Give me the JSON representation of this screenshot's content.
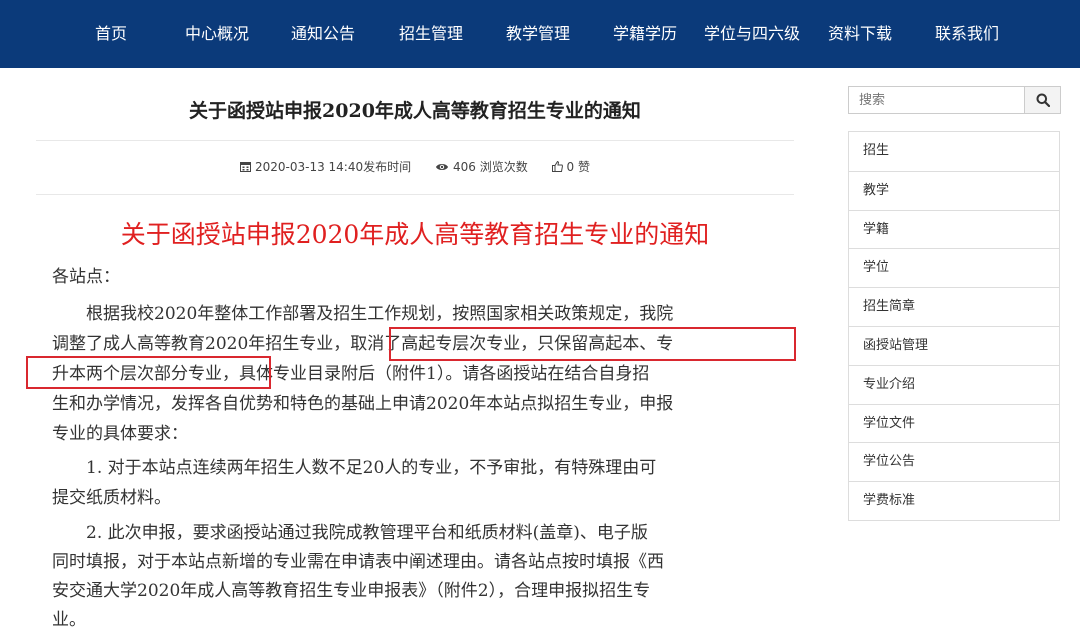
{
  "nav": {
    "items": [
      "首页",
      "中心概况",
      "通知公告",
      "招生管理",
      "教学管理",
      "学籍学历",
      "学位与四六级",
      "资料下载",
      "联系我们"
    ]
  },
  "article": {
    "title": "关于函授站申报2020年成人高等教育招生专业的通知",
    "meta": {
      "date": "2020-03-13 14:40",
      "date_label": "发布时间",
      "views": "406",
      "views_label": "浏览次数",
      "likes": "0",
      "likes_label": "赞"
    },
    "heading": "关于函授站申报2020年成人高等教育招生专业的通知",
    "lines": [
      "各站点：",
      "　　根据我校2020年整体工作部署及招生工作规划，按照国家相关政策规定，我院",
      "调整了成人高等教育2020年招生专业，取消了高起专层次专业，只保留高起本、专",
      "升本两个层次部分专业，具体专业目录附后（附件1）。请各函授站在结合自身招",
      "生和办学情况，发挥各自优势和特色的基础上申请2020年本站点拟招生专业，申报",
      "专业的具体要求：",
      "　　1. 对于本站点连续两年招生人数不足20人的专业，不予审批，有特殊理由可",
      "提交纸质材料。",
      "　　2. 此次申报，要求函授站通过我院成教管理平台和纸质材料(盖章)、电子版",
      "同时填报，对于本站点新增的专业需在申请表中阐述理由。请各站点按时填报《西",
      "安交通大学2020年成人高等教育招生专业申报表》（附件2），合理申报拟招生专",
      "业。"
    ]
  },
  "sidebar": {
    "search_placeholder": "搜索",
    "search_icon": "magnifier-icon",
    "items": [
      "招生",
      "教学",
      "学籍",
      "学位",
      "招生简章",
      "函授站管理",
      "专业介绍",
      "学位文件",
      "学位公告",
      "学费标准"
    ]
  },
  "colors": {
    "nav_bg": "#0b3a7a",
    "heading_red": "#e02020",
    "highlight_box": "#d9282f"
  }
}
